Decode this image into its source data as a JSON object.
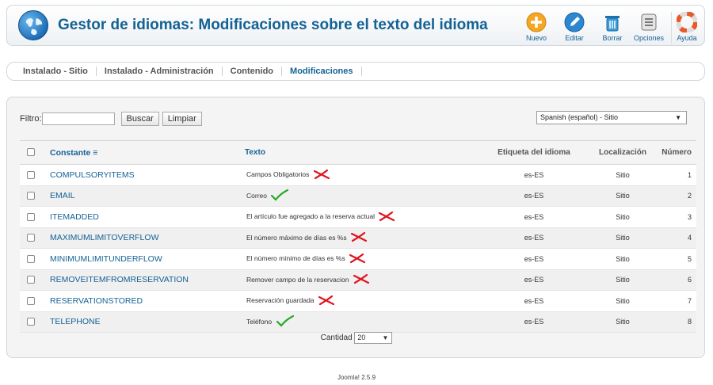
{
  "header": {
    "title": "Gestor de idiomas: Modificaciones sobre el texto del idioma",
    "toolbar": [
      {
        "label": "Nuevo",
        "icon": "plus-icon"
      },
      {
        "label": "Editar",
        "icon": "pencil-icon"
      },
      {
        "label": "Borrar",
        "icon": "trash-icon"
      },
      {
        "label": "Opciones",
        "icon": "options-icon"
      },
      {
        "label": "Ayuda",
        "icon": "help-icon"
      }
    ]
  },
  "subnav": {
    "tabs": [
      "Instalado - Sitio",
      "Instalado - Administración",
      "Contenido",
      "Modificaciones"
    ],
    "active": "Modificaciones"
  },
  "filter": {
    "label": "Filtro:",
    "value": "",
    "search_button": "Buscar",
    "clear_button": "Limpiar",
    "language_selected": "Spanish (español) - Sitio"
  },
  "table": {
    "columns": [
      "Constante",
      "Texto",
      "Etiqueta del idioma",
      "Localización",
      "Número"
    ],
    "rows": [
      {
        "constant": "COMPULSORYITEMS",
        "text": "Campos Obligatorios",
        "tag": "es-ES",
        "location": "Sitio",
        "number": "1",
        "mark": "cross"
      },
      {
        "constant": "EMAIL",
        "text": "Correo",
        "tag": "es-ES",
        "location": "Sitio",
        "number": "2",
        "mark": "check"
      },
      {
        "constant": "ITEMADDED",
        "text": "El artículo fue agregado a la reserva actual",
        "tag": "es-ES",
        "location": "Sitio",
        "number": "3",
        "mark": "cross"
      },
      {
        "constant": "MAXIMUMLIMITOVERFLOW",
        "text": "El número máximo de días es %s",
        "tag": "es-ES",
        "location": "Sitio",
        "number": "4",
        "mark": "cross"
      },
      {
        "constant": "MINIMUMLIMITUNDERFLOW",
        "text": "El número mínimo de días es %s",
        "tag": "es-ES",
        "location": "Sitio",
        "number": "5",
        "mark": "cross"
      },
      {
        "constant": "REMOVEITEMFROMRESERVATION",
        "text": "Remover campo de la reservacion",
        "tag": "es-ES",
        "location": "Sitio",
        "number": "6",
        "mark": "cross"
      },
      {
        "constant": "RESERVATIONSTORED",
        "text": "Reservación guardada",
        "tag": "es-ES",
        "location": "Sitio",
        "number": "7",
        "mark": "cross"
      },
      {
        "constant": "TELEPHONE",
        "text": "Teléfono",
        "tag": "es-ES",
        "location": "Sitio",
        "number": "8",
        "mark": "check"
      }
    ]
  },
  "pagination": {
    "label": "Cantidad",
    "value": "20"
  },
  "footer": {
    "version": "Joomla! 2.5.9"
  },
  "colors": {
    "title": "#146295",
    "cross": "#e0141e",
    "check": "#27a827"
  }
}
